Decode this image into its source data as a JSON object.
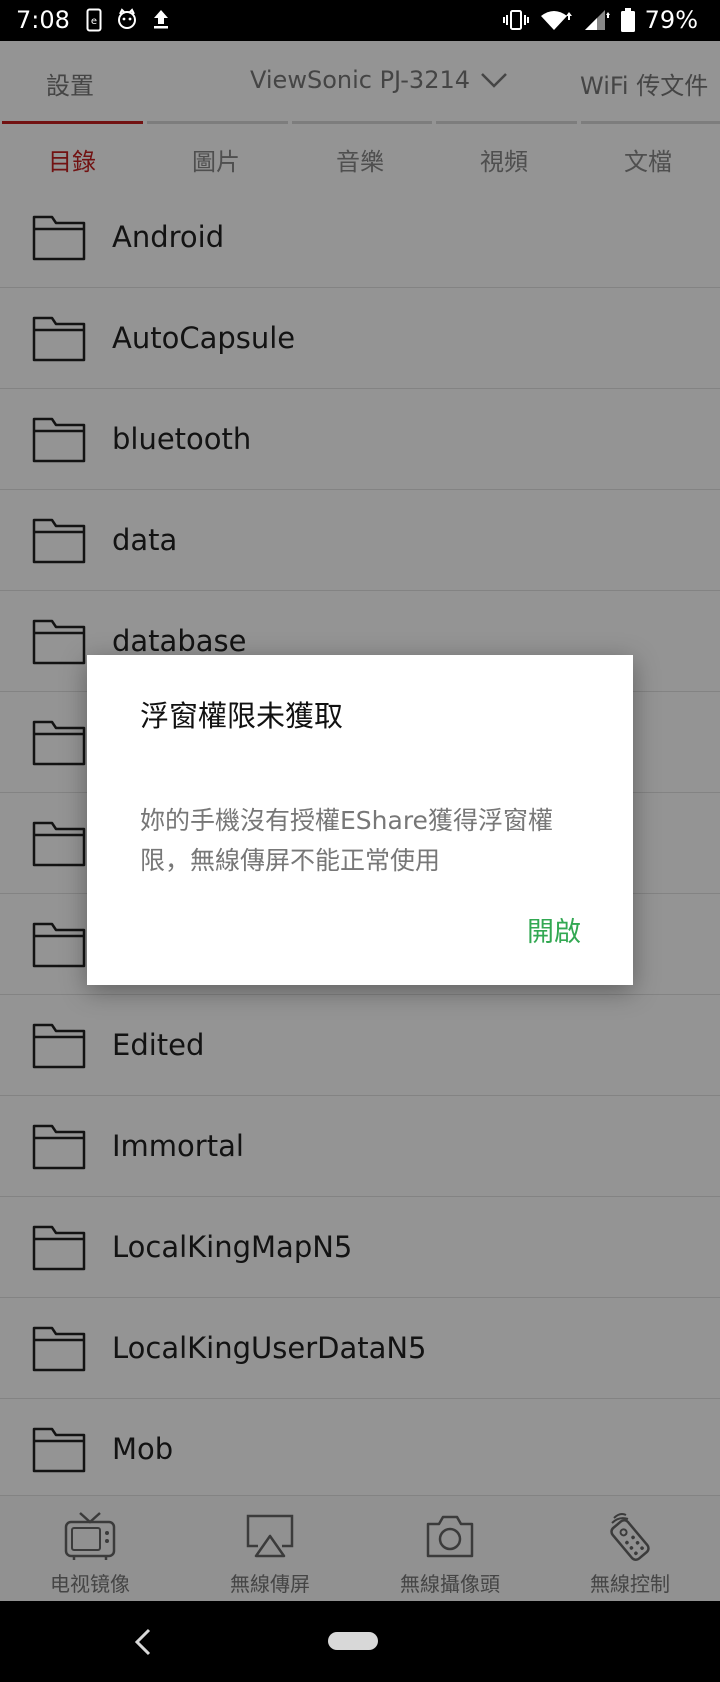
{
  "status_bar": {
    "time": "7:08",
    "battery": "79%",
    "left_icons": [
      "sim-card-icon",
      "cat-face-icon",
      "upload-icon"
    ],
    "right_icons": [
      "vibrate-icon",
      "wifi-icon",
      "signal-icon",
      "battery-icon"
    ]
  },
  "top_tabs": {
    "settings": "設置",
    "device": "ViewSonic PJ-3214",
    "wifi": "WiFi 传文件"
  },
  "sub_tabs": [
    {
      "label": "目錄",
      "active": true
    },
    {
      "label": "圖片",
      "active": false
    },
    {
      "label": "音樂",
      "active": false
    },
    {
      "label": "視頻",
      "active": false
    },
    {
      "label": "文檔",
      "active": false
    }
  ],
  "folders": [
    "Android",
    "AutoCapsule",
    "bluetooth",
    "data",
    "database",
    "",
    "",
    "",
    "Edited",
    "Immortal",
    "LocalKingMapN5",
    "LocalKingUserDataN5",
    "Mob"
  ],
  "bottom_nav": [
    {
      "label": "电视镜像",
      "icon": "tv-icon"
    },
    {
      "label": "無線傳屏",
      "icon": "airplay-icon"
    },
    {
      "label": "無線攝像頭",
      "icon": "camera-icon"
    },
    {
      "label": "無線控制",
      "icon": "remote-control-icon"
    }
  ],
  "dialog": {
    "title": "浮窗權限未獲取",
    "message": "妳的手機沒有授權EShare獲得浮窗權限，無線傳屏不能正常使用",
    "action": "開啟"
  },
  "colors": {
    "accent_red": "#c41f1f",
    "action_green": "#32a852"
  }
}
